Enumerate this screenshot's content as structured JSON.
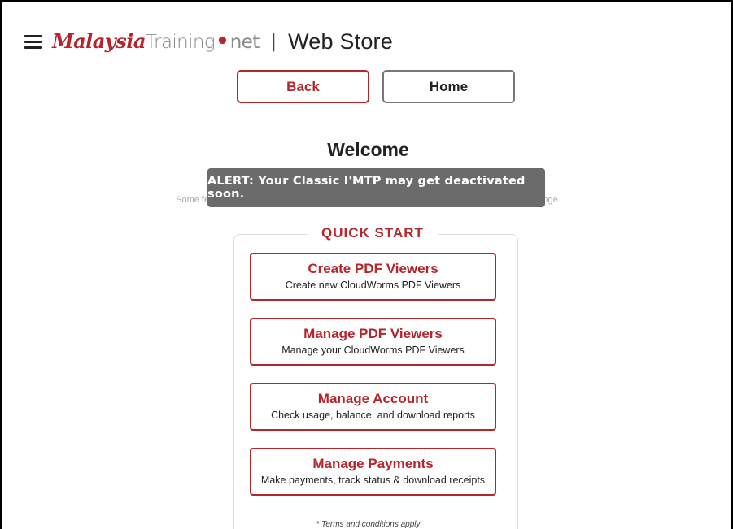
{
  "header": {
    "logo_part1": "Malaysia",
    "logo_part2": "Training",
    "logo_dot": "•",
    "logo_part3": "net",
    "separator": "|",
    "title": "Web Store"
  },
  "nav": {
    "back_label": "Back",
    "home_label": "Home"
  },
  "main": {
    "welcome": "Welcome",
    "note": "Some features, designs, and functionalities are not final, not yet available, and subject to change.",
    "alert": "ALERT: Your Classic I'MTP may get deactivated soon."
  },
  "quick_start": {
    "title": "QUICK START",
    "items": [
      {
        "title": "Create PDF Viewers",
        "desc": "Create new CloudWorms PDF Viewers"
      },
      {
        "title": "Manage PDF Viewers",
        "desc": "Manage your CloudWorms PDF Viewers"
      },
      {
        "title": "Manage Account",
        "desc": "Check usage, balance, and download reports"
      },
      {
        "title": "Manage Payments",
        "desc": "Make payments, track status & download receipts"
      }
    ],
    "terms": "* Terms and conditions apply"
  },
  "colors": {
    "brand_red": "#b5262c",
    "alert_bg": "#6b6b6b"
  },
  "icons": [
    "menu-icon"
  ]
}
